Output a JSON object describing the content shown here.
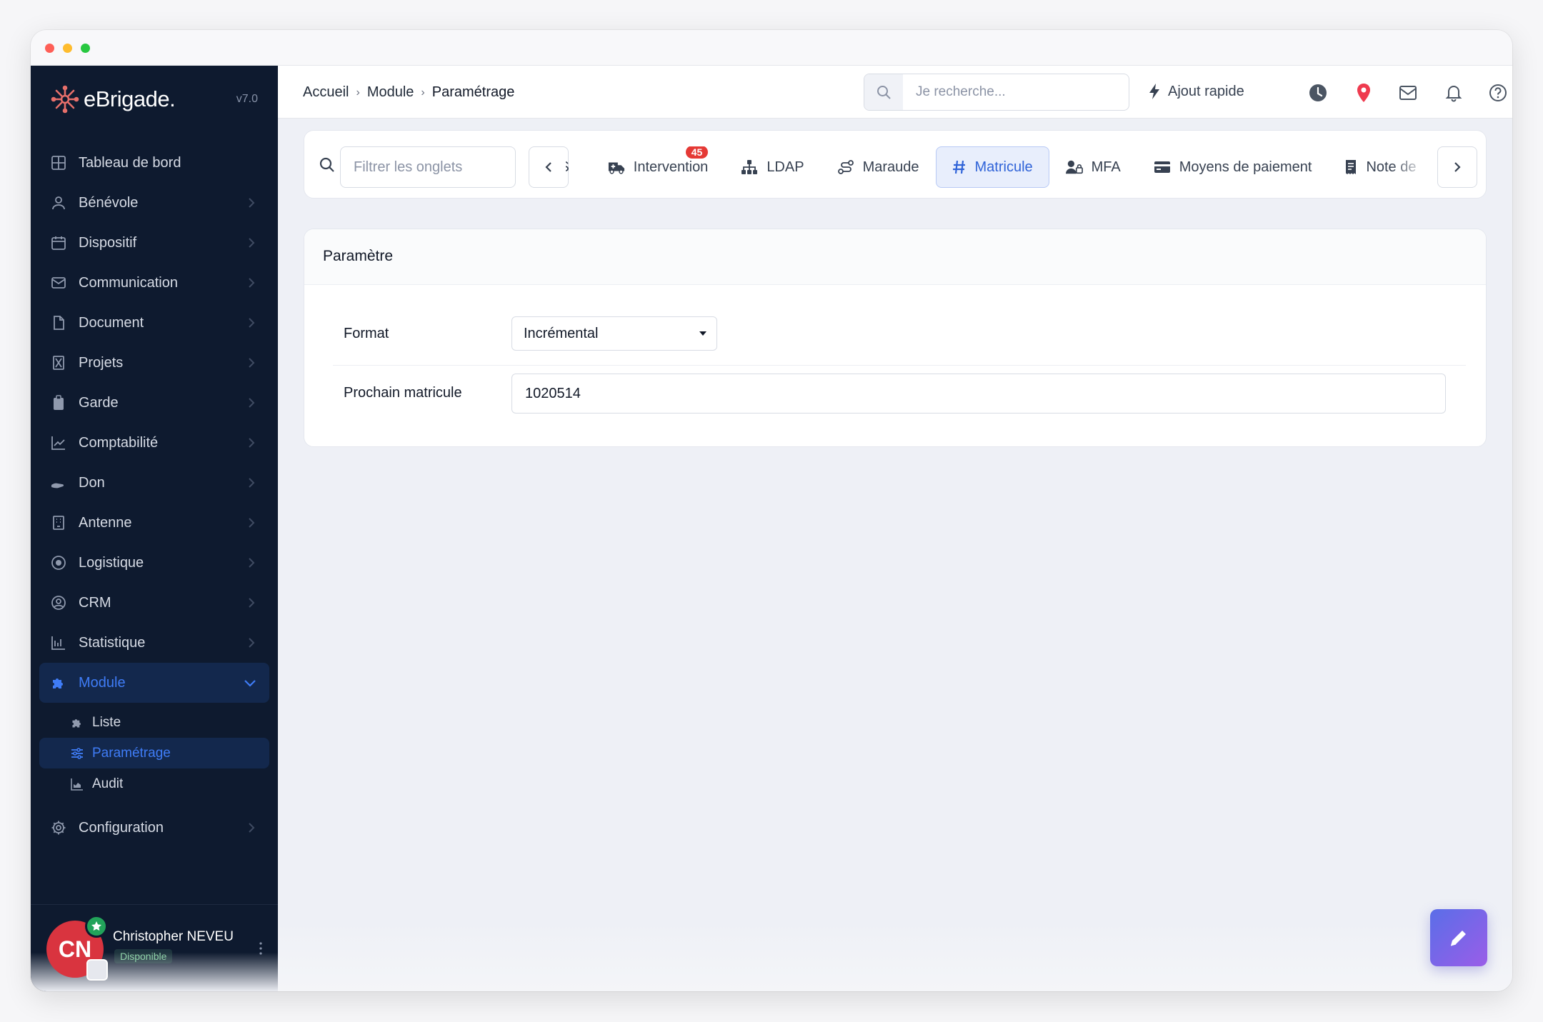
{
  "app": {
    "name": "eBrigade.",
    "version": "v7.0"
  },
  "breadcrumb": {
    "items": [
      "Accueil",
      "Module",
      "Paramétrage"
    ],
    "separator": "›"
  },
  "search": {
    "placeholder": "Je recherche..."
  },
  "topbar": {
    "quick_add_label": "Ajout rapide"
  },
  "sidebar": {
    "items": [
      {
        "label": "Tableau de bord",
        "icon": "dashboard-icon"
      },
      {
        "label": "Bénévole",
        "icon": "user-icon"
      },
      {
        "label": "Dispositif",
        "icon": "calendar-icon"
      },
      {
        "label": "Communication",
        "icon": "envelope-icon"
      },
      {
        "label": "Document",
        "icon": "file-icon"
      },
      {
        "label": "Projets",
        "icon": "hourglass-icon"
      },
      {
        "label": "Garde",
        "icon": "clipboard-icon"
      },
      {
        "label": "Comptabilité",
        "icon": "chart-line-icon"
      },
      {
        "label": "Don",
        "icon": "hand-icon"
      },
      {
        "label": "Antenne",
        "icon": "building-icon"
      },
      {
        "label": "Logistique",
        "icon": "circle-dot-icon"
      },
      {
        "label": "CRM",
        "icon": "user-circle-icon"
      },
      {
        "label": "Statistique",
        "icon": "chart-bar-icon"
      }
    ],
    "module": {
      "label": "Module",
      "icon": "puzzle-icon",
      "subitems": [
        {
          "label": "Liste",
          "icon": "puzzle-icon"
        },
        {
          "label": "Paramétrage",
          "icon": "sliders-icon"
        },
        {
          "label": "Audit",
          "icon": "chart-area-icon"
        }
      ]
    },
    "configuration": {
      "label": "Configuration",
      "icon": "gear-icon"
    }
  },
  "user": {
    "initials": "CN",
    "name": "Christopher NEVEU",
    "status": "Disponible"
  },
  "tabs": {
    "filter_placeholder": "Filtrer les onglets",
    "items": [
      {
        "label": "DS",
        "icon": ""
      },
      {
        "label": "Intervention",
        "icon": "ambulance-icon",
        "badge": "45"
      },
      {
        "label": "LDAP",
        "icon": "sitemap-icon"
      },
      {
        "label": "Maraude",
        "icon": "route-icon"
      },
      {
        "label": "Matricule",
        "icon": "hashtag-icon",
        "active": true
      },
      {
        "label": "MFA",
        "icon": "user-lock-icon"
      },
      {
        "label": "Moyens de paiement",
        "icon": "credit-card-icon"
      },
      {
        "label": "Note de",
        "icon": "receipt-icon"
      }
    ]
  },
  "parametre": {
    "title": "Paramètre",
    "format_label": "Format",
    "format_value": "Incrémental",
    "next_label": "Prochain matricule",
    "next_value": "1020514"
  },
  "colors": {
    "sidebar_bg": "#0e1a2f",
    "accent": "#3f7cf6",
    "active_tab_bg": "#e8eefc",
    "badge": "#e53935",
    "avatar": "#d9343f"
  }
}
